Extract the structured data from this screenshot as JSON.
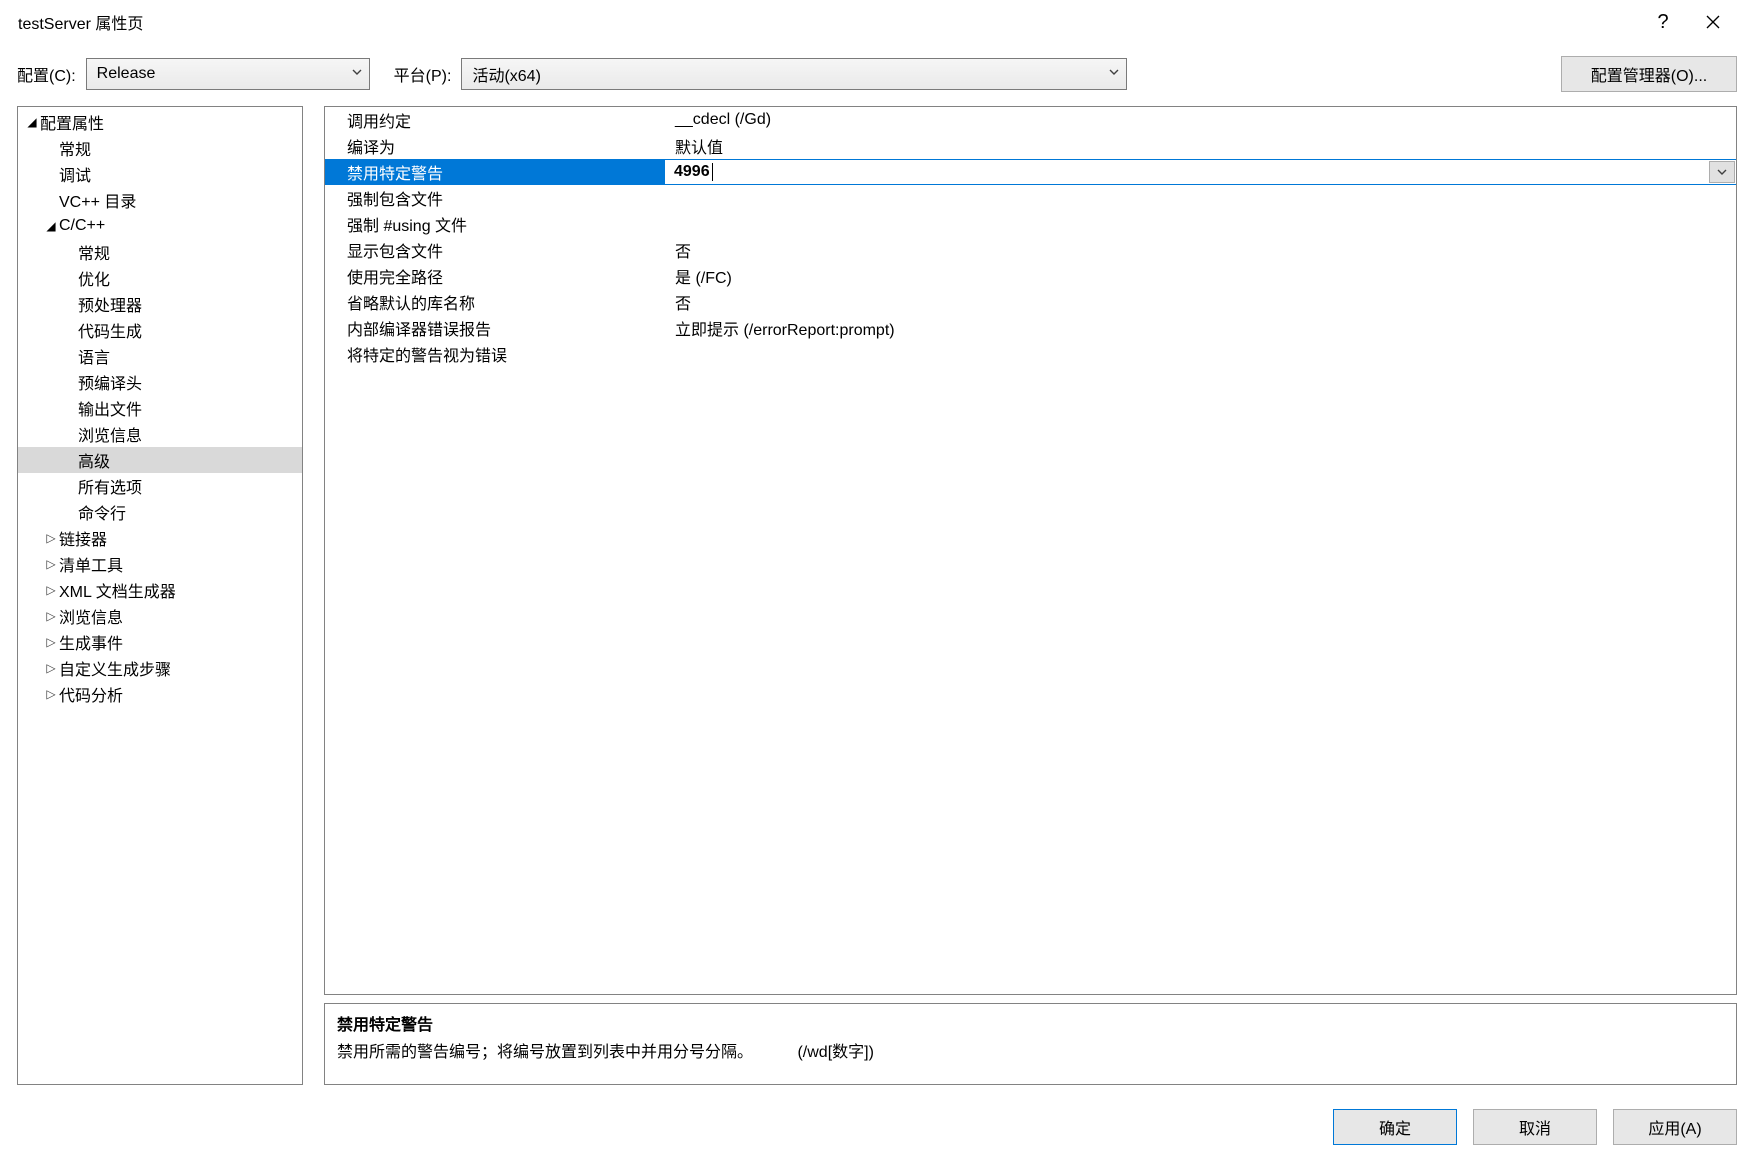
{
  "window": {
    "title": "testServer 属性页"
  },
  "toolbar": {
    "config_label": "配置(C):",
    "config_value": "Release",
    "platform_label": "平台(P):",
    "platform_value": "活动(x64)",
    "manager_button": "配置管理器(O)..."
  },
  "tree": {
    "root": "配置属性",
    "items_level1": {
      "general": "常规",
      "debug": "调试",
      "vcdirs": "VC++ 目录"
    },
    "cpp": "C/C++",
    "cpp_children": {
      "general": "常规",
      "opt": "优化",
      "preproc": "预处理器",
      "codegen": "代码生成",
      "lang": "语言",
      "pch": "预编译头",
      "outfiles": "输出文件",
      "browse": "浏览信息",
      "advanced": "高级",
      "allopts": "所有选项",
      "cmdline": "命令行"
    },
    "tail": {
      "linker": "链接器",
      "manifest": "清单工具",
      "xmldoc": "XML 文档生成器",
      "browseinfo": "浏览信息",
      "buildevents": "生成事件",
      "custom": "自定义生成步骤",
      "codeanalysis": "代码分析"
    }
  },
  "props": {
    "rows": [
      {
        "label": "调用约定",
        "value": "__cdecl (/Gd)"
      },
      {
        "label": "编译为",
        "value": "默认值"
      },
      {
        "label": "禁用特定警告",
        "value": "4996"
      },
      {
        "label": "强制包含文件",
        "value": ""
      },
      {
        "label": "强制 #using 文件",
        "value": ""
      },
      {
        "label": "显示包含文件",
        "value": "否"
      },
      {
        "label": "使用完全路径",
        "value": "是 (/FC)"
      },
      {
        "label": "省略默认的库名称",
        "value": "否"
      },
      {
        "label": "内部编译器错误报告",
        "value": "立即提示 (/errorReport:prompt)"
      },
      {
        "label": "将特定的警告视为错误",
        "value": ""
      }
    ]
  },
  "description": {
    "title": "禁用特定警告",
    "text": "禁用所需的警告编号；将编号放置到列表中并用分号分隔。",
    "switch": "(/wd[数字])"
  },
  "buttons": {
    "ok": "确定",
    "cancel": "取消",
    "apply": "应用(A)"
  }
}
